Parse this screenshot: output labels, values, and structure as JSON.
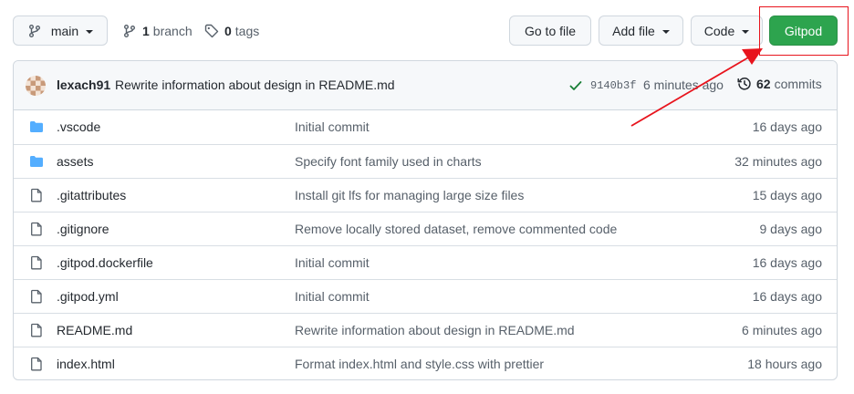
{
  "branch_selector": {
    "label": "main"
  },
  "branches": {
    "count": "1",
    "label": "branch"
  },
  "tags": {
    "count": "0",
    "label": "tags"
  },
  "toolbar": {
    "go_to_file": "Go to file",
    "add_file": "Add file",
    "code": "Code",
    "gitpod": "Gitpod"
  },
  "latest_commit": {
    "author": "lexach91",
    "message": "Rewrite information about design in README.md",
    "sha": "9140b3f",
    "age": "6 minutes ago",
    "commits_count": "62",
    "commits_label": "commits"
  },
  "files": [
    {
      "type": "folder",
      "name": ".vscode",
      "message": "Initial commit",
      "age": "16 days ago"
    },
    {
      "type": "folder",
      "name": "assets",
      "message": "Specify font family used in charts",
      "age": "32 minutes ago"
    },
    {
      "type": "file",
      "name": ".gitattributes",
      "message": "Install git lfs for managing large size files",
      "age": "15 days ago"
    },
    {
      "type": "file",
      "name": ".gitignore",
      "message": "Remove locally stored dataset, remove commented code",
      "age": "9 days ago"
    },
    {
      "type": "file",
      "name": ".gitpod.dockerfile",
      "message": "Initial commit",
      "age": "16 days ago"
    },
    {
      "type": "file",
      "name": ".gitpod.yml",
      "message": "Initial commit",
      "age": "16 days ago"
    },
    {
      "type": "file",
      "name": "README.md",
      "message": "Rewrite information about design in README.md",
      "age": "6 minutes ago"
    },
    {
      "type": "file",
      "name": "index.html",
      "message": "Format index.html and style.css with prettier",
      "age": "18 hours ago"
    }
  ],
  "colors": {
    "folder": "#54aeff",
    "accent_green": "#2da44e",
    "annotation_red": "#e8141d"
  },
  "icons": {
    "branch": "git-branch-icon",
    "tag": "tag-icon",
    "check": "check-icon",
    "history": "history-icon",
    "folder": "folder-icon",
    "file": "file-icon"
  }
}
